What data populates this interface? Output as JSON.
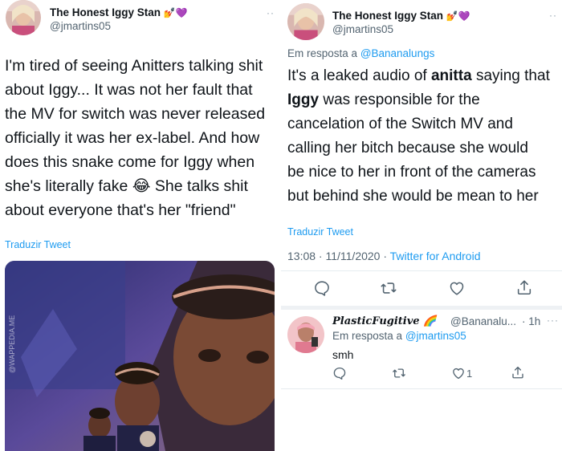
{
  "left_tweet": {
    "author_name": "The Honest Iggy Stan",
    "author_emoji": "💅💜",
    "author_handle": "@jmartins05",
    "more": "··",
    "text_lines": [
      "I'm tired of seeing Anitters talking shit",
      "about Iggy... It was not her fault that",
      "the MV for switch was never released",
      "officially it was her ex-label. And how",
      "does this snake come for Iggy when",
      "she's literally fake 😂 She talks shit",
      "about everyone that's her \"friend\""
    ],
    "translate": "Traduzir Tweet",
    "media_watermark": "@WAPPEDIA.ME"
  },
  "right_tweet": {
    "author_name": "The Honest Iggy Stan",
    "author_emoji": "💅💜",
    "author_handle": "@jmartins05",
    "more": "··",
    "reply_prefix": "Em resposta a",
    "reply_mention": "@Bananalungs",
    "text": {
      "l1_a": "It's a leaked audio of ",
      "l1_b": "anitta",
      "l1_c": " saying that",
      "l2_a": "Iggy",
      "l2_b": " was responsible for the",
      "l3": "cancelation of the Switch MV and",
      "l4": "calling her bitch because she would",
      "l5": "be nice to her in front of the cameras",
      "l6": "but behind she would be mean to her"
    },
    "translate": "Traduzir Tweet",
    "timestamp": "13:08 · 11/11/2020 · ",
    "source": "Twitter for Android"
  },
  "reply": {
    "author_name": "PlasticFugitive 🌈",
    "author_handle": "@Bananalu...",
    "time": "· 1h",
    "more": "···",
    "reply_prefix": "Em resposta a",
    "reply_mention": "@jmartins05",
    "text": "smh",
    "like_count": "1"
  },
  "colors": {
    "accent": "#1d9bf0",
    "secondary_text": "#536471",
    "divider": "#e6ecf0"
  },
  "icons": [
    "reply-icon",
    "retweet-icon",
    "like-icon",
    "share-icon"
  ]
}
